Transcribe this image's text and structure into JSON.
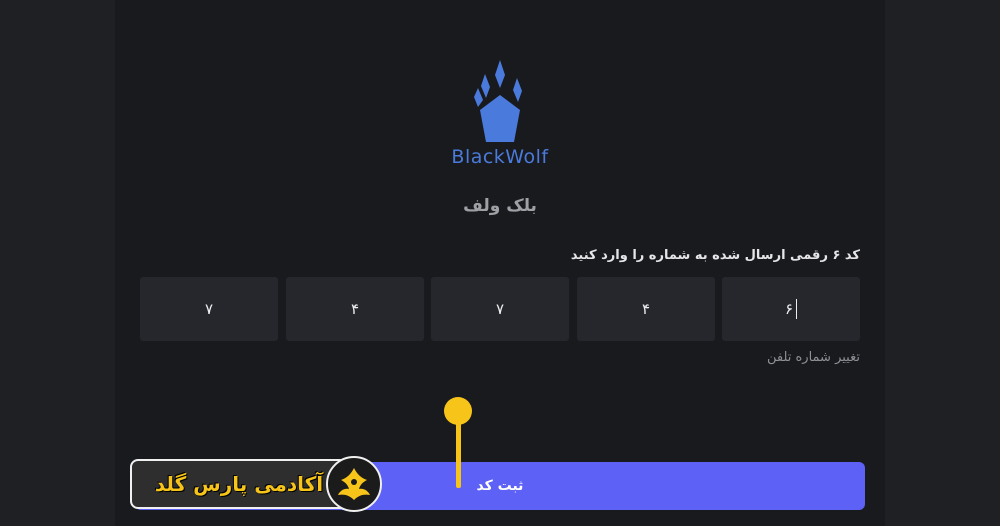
{
  "brand": {
    "name": "BlackWolf",
    "title_fa": "بلک ولف"
  },
  "verify": {
    "instruction": "کد ۶ رقمی ارسال شده به شماره را وارد کنید",
    "digits": [
      "۷",
      "۴",
      "۷",
      "۴",
      "۶"
    ],
    "change_phone_label": "تغییر شماره تلفن",
    "submit_label": "ثبت کد"
  },
  "watermark": {
    "text": "آکادمی پارس گلد"
  },
  "colors": {
    "accent": "#5d61f5",
    "logo_blue": "#4a7bdc",
    "pointer_yellow": "#f7c41a",
    "background": "#1f2024",
    "panel": "#191a1e",
    "input_bg": "#25272d"
  },
  "icons": {
    "logo": "wolf-paw-icon",
    "emblem": "phoenix-icon"
  }
}
